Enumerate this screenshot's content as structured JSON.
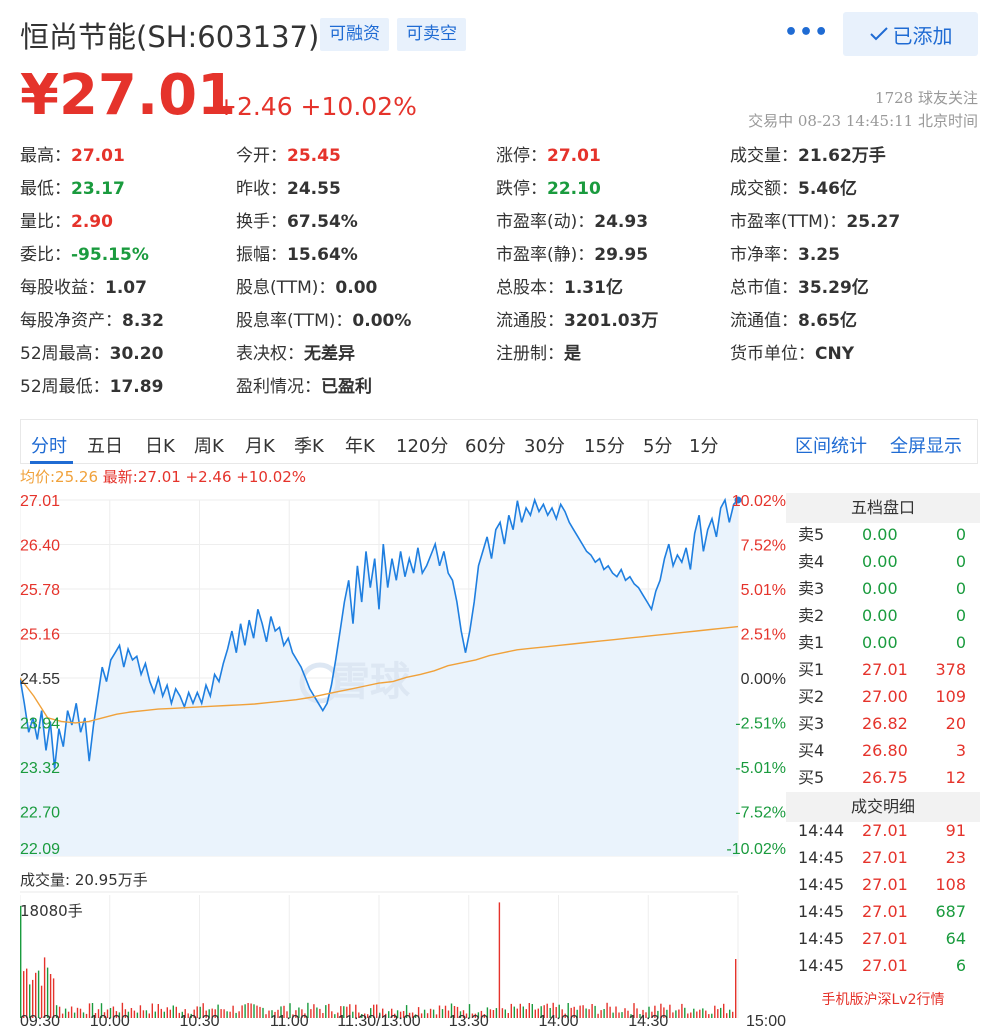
{
  "header": {
    "stock_name": "恒尚节能(SH:603137)",
    "tags": [
      "可融资",
      "可卖空"
    ],
    "more_label": "•••",
    "added_label": "已添加",
    "price": "¥27.01",
    "change": "+2.46 +10.02%",
    "followers": "1728 球友关注",
    "trade_status": "交易中 08-23 14:45:11 北京时间"
  },
  "quote": [
    [
      {
        "label": "最高：",
        "value": "27.01",
        "color": "red"
      },
      {
        "label": "今开：",
        "value": "25.45",
        "color": "red"
      },
      {
        "label": "涨停：",
        "value": "27.01",
        "color": "red"
      },
      {
        "label": "成交量：",
        "value": "21.62万手",
        "color": ""
      }
    ],
    [
      {
        "label": "最低：",
        "value": "23.17",
        "color": "green"
      },
      {
        "label": "昨收：",
        "value": "24.55",
        "color": ""
      },
      {
        "label": "跌停：",
        "value": "22.10",
        "color": "green"
      },
      {
        "label": "成交额：",
        "value": "5.46亿",
        "color": ""
      }
    ],
    [
      {
        "label": "量比：",
        "value": "2.90",
        "color": "red"
      },
      {
        "label": "换手：",
        "value": "67.54%",
        "color": ""
      },
      {
        "label": "市盈率(动)：",
        "value": "24.93",
        "color": ""
      },
      {
        "label": "市盈率(TTM)：",
        "value": "25.27",
        "color": ""
      }
    ],
    [
      {
        "label": "委比：",
        "value": "-95.15%",
        "color": "green"
      },
      {
        "label": "振幅：",
        "value": "15.64%",
        "color": ""
      },
      {
        "label": "市盈率(静)：",
        "value": "29.95",
        "color": ""
      },
      {
        "label": "市净率：",
        "value": "3.25",
        "color": ""
      }
    ],
    [
      {
        "label": "每股收益：",
        "value": "1.07",
        "color": ""
      },
      {
        "label": "股息(TTM)：",
        "value": "0.00",
        "color": ""
      },
      {
        "label": "总股本：",
        "value": "1.31亿",
        "color": ""
      },
      {
        "label": "总市值：",
        "value": "35.29亿",
        "color": ""
      }
    ],
    [
      {
        "label": "每股净资产：",
        "value": "8.32",
        "color": ""
      },
      {
        "label": "股息率(TTM)：",
        "value": "0.00%",
        "color": ""
      },
      {
        "label": "流通股：",
        "value": "3201.03万",
        "color": ""
      },
      {
        "label": "流通值：",
        "value": "8.65亿",
        "color": ""
      }
    ],
    [
      {
        "label": "52周最高：",
        "value": "30.20",
        "color": ""
      },
      {
        "label": "表决权：",
        "value": "无差异",
        "color": ""
      },
      {
        "label": "注册制：",
        "value": "是",
        "color": ""
      },
      {
        "label": "货币单位：",
        "value": "CNY",
        "color": ""
      }
    ],
    [
      {
        "label": "52周最低：",
        "value": "17.89",
        "color": ""
      },
      {
        "label": "盈利情况：",
        "value": "已盈利",
        "color": ""
      },
      null,
      null
    ]
  ],
  "tabs": [
    "分时",
    "五日",
    "日K",
    "周K",
    "月K",
    "季K",
    "年K",
    "120分",
    "60分",
    "30分",
    "15分",
    "5分",
    "1分"
  ],
  "tabs_right": [
    "区间统计",
    "全屏显示"
  ],
  "legend": {
    "avg": "均价:25.26",
    "latest": "最新:27.01 +2.46 +10.02%"
  },
  "volume_label": "成交量: 20.95万手",
  "volume_max_label": "18080手",
  "watermark": "雪球",
  "orderbook": {
    "title": "五档盘口",
    "asks": [
      {
        "label": "卖5",
        "price": "0.00",
        "vol": "0"
      },
      {
        "label": "卖4",
        "price": "0.00",
        "vol": "0"
      },
      {
        "label": "卖3",
        "price": "0.00",
        "vol": "0"
      },
      {
        "label": "卖2",
        "price": "0.00",
        "vol": "0"
      },
      {
        "label": "卖1",
        "price": "0.00",
        "vol": "0"
      }
    ],
    "bids": [
      {
        "label": "买1",
        "price": "27.01",
        "vol": "378"
      },
      {
        "label": "买2",
        "price": "27.00",
        "vol": "109"
      },
      {
        "label": "买3",
        "price": "26.82",
        "vol": "20"
      },
      {
        "label": "买4",
        "price": "26.80",
        "vol": "3"
      },
      {
        "label": "买5",
        "price": "26.75",
        "vol": "12"
      }
    ],
    "trades_title": "成交明细",
    "trades": [
      {
        "time": "14:44",
        "price": "27.01",
        "vol": "91"
      },
      {
        "time": "14:45",
        "price": "27.01",
        "vol": "23"
      },
      {
        "time": "14:45",
        "price": "27.01",
        "vol": "108"
      },
      {
        "time": "14:45",
        "price": "27.01",
        "vol": "687"
      },
      {
        "time": "14:45",
        "price": "27.01",
        "vol": "64"
      },
      {
        "time": "14:45",
        "price": "27.01",
        "vol": "6"
      }
    ],
    "lv2_link": "手机版沪深Lv2行情"
  },
  "colors": {
    "up": "#e5332b",
    "down": "#1a9b3e",
    "accent": "#1f6bd3",
    "avg": "#f0a13a"
  },
  "chart_data": {
    "type": "line",
    "title": "",
    "y_left_ticks": [
      "27.01",
      "26.40",
      "25.78",
      "25.16",
      "24.55",
      "23.94",
      "23.32",
      "22.70",
      "22.09"
    ],
    "y_right_ticks": [
      "10.02%",
      "7.52%",
      "5.01%",
      "2.51%",
      "0.00%",
      "-2.51%",
      "-5.01%",
      "-7.52%",
      "-10.02%"
    ],
    "ylim": [
      22.09,
      27.01
    ],
    "x_ticks": [
      "09:30",
      "10:00",
      "10:30",
      "11:00",
      "11:30/13:00",
      "13:30",
      "14:00",
      "14:30",
      "15:00"
    ],
    "series": [
      {
        "name": "最新",
        "values": [
          24.55,
          24.2,
          23.8,
          24.0,
          23.7,
          24.1,
          23.55,
          23.95,
          23.3,
          23.85,
          23.6,
          24.1,
          23.9,
          24.2,
          23.8,
          24.0,
          23.4,
          23.9,
          24.3,
          24.7,
          24.5,
          24.8,
          24.9,
          25.0,
          24.7,
          24.95,
          24.8,
          24.85,
          24.6,
          24.75,
          24.5,
          24.35,
          24.55,
          24.3,
          24.45,
          24.2,
          24.4,
          24.3,
          24.15,
          24.35,
          24.2,
          24.35,
          24.2,
          24.45,
          24.3,
          24.6,
          24.5,
          24.75,
          24.95,
          25.2,
          24.9,
          25.3,
          25.0,
          25.35,
          25.1,
          25.5,
          25.3,
          25.05,
          25.4,
          25.2,
          25.25,
          25.0,
          25.1,
          24.9,
          24.8,
          24.7,
          24.55,
          24.4,
          24.3,
          24.2,
          24.1,
          24.2,
          24.45,
          24.8,
          25.2,
          25.6,
          25.9,
          25.3,
          26.1,
          25.6,
          26.3,
          25.8,
          26.2,
          25.5,
          26.4,
          25.8,
          26.2,
          25.9,
          26.3,
          25.95,
          26.2,
          26.0,
          26.35,
          26.0,
          26.1,
          26.25,
          26.4,
          26.1,
          26.3,
          26.0,
          25.9,
          25.6,
          25.2,
          24.9,
          25.2,
          25.6,
          26.1,
          26.3,
          26.5,
          26.2,
          26.6,
          26.7,
          26.4,
          26.8,
          26.6,
          27.0,
          26.7,
          26.9,
          26.8,
          27.01,
          26.85,
          26.95,
          26.8,
          26.9,
          26.75,
          26.95,
          26.85,
          26.7,
          26.6,
          26.5,
          26.4,
          26.3,
          26.25,
          26.15,
          26.2,
          26.05,
          26.1,
          26.0,
          25.95,
          26.05,
          25.9,
          25.95,
          25.85,
          25.8,
          25.7,
          25.6,
          25.5,
          25.75,
          25.9,
          26.2,
          26.4,
          26.1,
          26.25,
          26.15,
          26.35,
          26.05,
          26.55,
          26.8,
          26.3,
          26.6,
          26.75,
          26.5,
          26.9,
          27.01,
          26.7,
          26.95,
          27.01
        ]
      },
      {
        "name": "均价",
        "values": [
          24.55,
          24.3,
          24.0,
          23.95,
          23.93,
          23.95,
          24.0,
          24.05,
          24.08,
          24.1,
          24.12,
          24.13,
          24.14,
          24.15,
          24.16,
          24.17,
          24.18,
          24.19,
          24.21,
          24.23,
          24.25,
          24.28,
          24.32,
          24.36,
          24.4,
          24.44,
          24.48,
          24.5,
          24.56,
          24.6,
          24.65,
          24.72,
          24.76,
          24.8,
          24.86,
          24.9,
          24.94,
          24.96,
          24.98,
          25.0,
          25.02,
          25.04,
          25.06,
          25.08,
          25.1,
          25.12,
          25.14,
          25.16,
          25.18,
          25.2,
          25.22,
          25.24,
          25.26
        ]
      }
    ],
    "volume_max": "18080手",
    "volume_total": "20.95万手"
  }
}
